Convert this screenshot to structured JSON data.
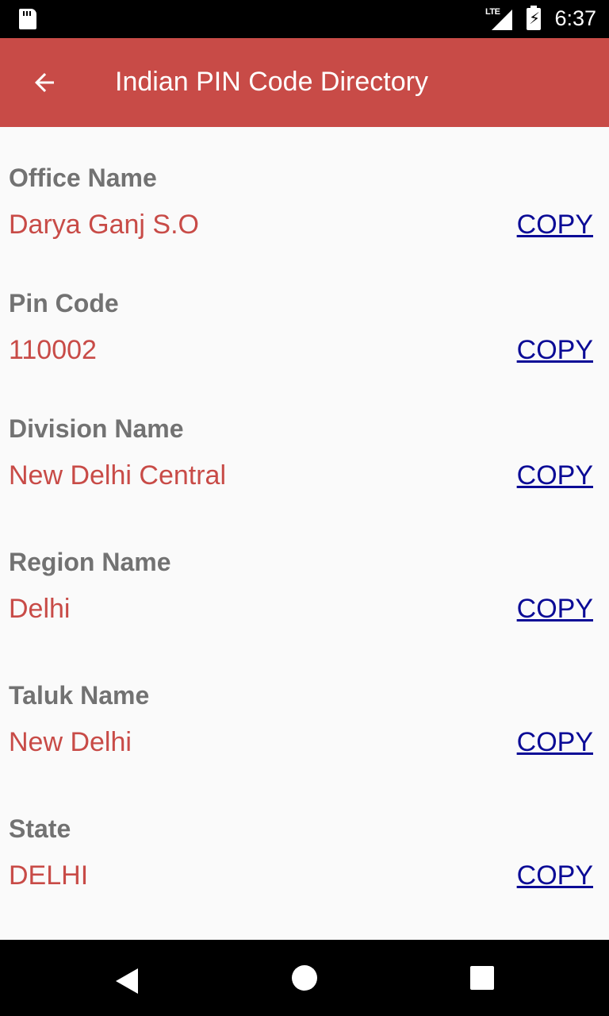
{
  "status_bar": {
    "network_label": "LTE",
    "time": "6:37",
    "icons": [
      "sd-card-icon",
      "lte-signal-icon",
      "battery-charging-icon"
    ]
  },
  "app_bar": {
    "back_icon": "arrow-back-icon",
    "title": "Indian PIN Code Directory"
  },
  "copy_label": "COPY",
  "fields": [
    {
      "label": "Office Name",
      "value": "Darya Ganj S.O"
    },
    {
      "label": "Pin Code",
      "value": "110002"
    },
    {
      "label": "Division Name",
      "value": "New Delhi Central"
    },
    {
      "label": "Region Name",
      "value": "Delhi"
    },
    {
      "label": "Taluk Name",
      "value": "New Delhi"
    },
    {
      "label": "State",
      "value": "DELHI"
    }
  ],
  "nav_bar": {
    "icons": [
      "nav-back-icon",
      "nav-home-icon",
      "nav-recents-icon"
    ]
  },
  "colors": {
    "primary": "#c84b47",
    "label": "#727272",
    "link": "#0b0b96",
    "background": "#fafafa"
  }
}
